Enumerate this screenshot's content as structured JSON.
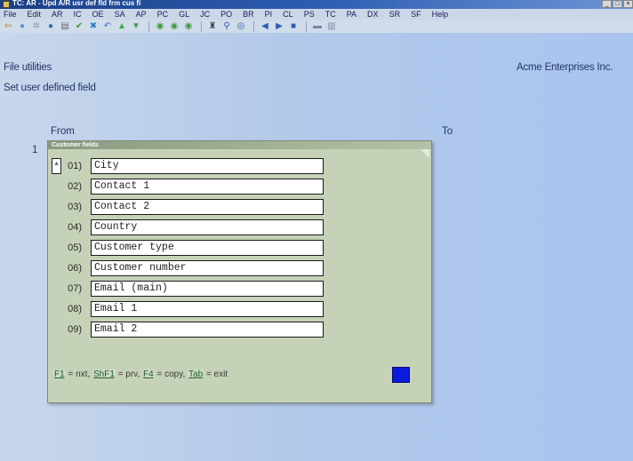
{
  "window": {
    "title": "TC: AR - Upd A/R usr def fld frm cus fi",
    "buttons": [
      "_",
      "□",
      "×"
    ]
  },
  "menu": [
    "File",
    "Edit",
    "AR",
    "IC",
    "OE",
    "SA",
    "AP",
    "PC",
    "GL",
    "JC",
    "PO",
    "BR",
    "PI",
    "CL",
    "PS",
    "TC",
    "PA",
    "DX",
    "SR",
    "SF",
    "Help"
  ],
  "toolbar": {
    "icons": [
      {
        "name": "exit-icon",
        "glyph": "⇦",
        "color": "#c97b18"
      },
      {
        "name": "stop-icon",
        "glyph": "●",
        "color": "#5a8ed6"
      },
      {
        "name": "tools-icon",
        "glyph": "✲",
        "color": "#8a9aaa"
      },
      {
        "name": "globe-icon",
        "glyph": "●",
        "color": "#3c63b8"
      },
      {
        "name": "print-icon",
        "glyph": "▤",
        "color": "#666"
      },
      {
        "name": "check-icon",
        "glyph": "✔",
        "color": "#3a9a3a"
      },
      {
        "name": "cancel-icon",
        "glyph": "✖",
        "color": "#2f7fcf"
      },
      {
        "name": "undo-icon",
        "glyph": "↶",
        "color": "#3f6fd0"
      },
      {
        "name": "up-icon",
        "glyph": "▲",
        "color": "#3aa64a"
      },
      {
        "name": "down-icon",
        "glyph": "▼",
        "color": "#3aa64a"
      },
      {
        "sep": true
      },
      {
        "name": "refresh-icon",
        "glyph": "◉",
        "color": "#3a9a3a"
      },
      {
        "name": "record-icon",
        "glyph": "◉",
        "color": "#3a9a3a"
      },
      {
        "name": "disc-icon",
        "glyph": "◉",
        "color": "#3a9a3a"
      },
      {
        "sep": true
      },
      {
        "name": "find-icon",
        "glyph": "♜",
        "color": "#444"
      },
      {
        "name": "zoom-icon",
        "glyph": "⚲",
        "color": "#2d5db1"
      },
      {
        "name": "filter-icon",
        "glyph": "◎",
        "color": "#2d5db1"
      },
      {
        "sep": true
      },
      {
        "name": "prev-icon",
        "glyph": "◀",
        "color": "#2d5db1"
      },
      {
        "name": "next-icon",
        "glyph": "▶",
        "color": "#2d5db1"
      },
      {
        "name": "end-icon",
        "glyph": "■",
        "color": "#2d5db1"
      },
      {
        "sep": true
      },
      {
        "name": "save-icon",
        "glyph": "▬",
        "color": "#7888a8"
      },
      {
        "name": "doc-icon",
        "glyph": "▥",
        "color": "#7888a8"
      }
    ]
  },
  "header": {
    "module": "File utilities",
    "company": "Acme Enterprises Inc.",
    "subtitle": "Set user defined field"
  },
  "labels": {
    "from": "From",
    "to": "To",
    "row_number": "1"
  },
  "dialog": {
    "title": "Customer fields",
    "marker": "*",
    "fields": [
      {
        "num": "01)",
        "value": "City",
        "selected": true
      },
      {
        "num": "02)",
        "value": "Contact 1"
      },
      {
        "num": "03)",
        "value": "Contact 2"
      },
      {
        "num": "04)",
        "value": "Country"
      },
      {
        "num": "05)",
        "value": "Customer type"
      },
      {
        "num": "06)",
        "value": "Customer number"
      },
      {
        "num": "07)",
        "value": "Email (main)"
      },
      {
        "num": "08)",
        "value": "Email 1"
      },
      {
        "num": "09)",
        "value": "Email 2"
      }
    ],
    "keys": {
      "f1": "F1",
      "f1_text": "= nxt,",
      "shf1": "ShF1",
      "shf1_text": "= prv,",
      "f4": "F4",
      "f4_text": "= copy,",
      "tab": "Tab",
      "tab_text": "= exit"
    },
    "indicator_color": "#0a1adf"
  }
}
